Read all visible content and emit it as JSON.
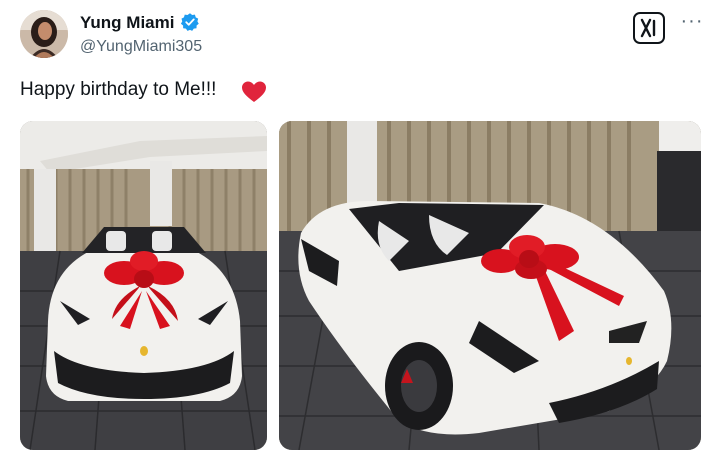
{
  "author": {
    "display_name": "Yung Miami",
    "handle": "@YungMiami305",
    "verified": true,
    "verified_color": "#1d9bf0"
  },
  "actions": {
    "brand_icon": "x-logo-icon",
    "more_icon": "more-options-icon",
    "more_label": "···"
  },
  "tweet": {
    "text": "Happy birthday to Me!!!",
    "emoji": "heart-icon",
    "emoji_color": "#e0243c"
  },
  "media": [
    {
      "subject": "white convertible sports car with a red gift bow, front view"
    },
    {
      "subject": "white convertible sports car with a red gift bow, three-quarter view"
    }
  ],
  "colors": {
    "text_primary": "#0f1419",
    "text_secondary": "#536471",
    "bow": "#d8121e",
    "car_body": "#f2f1ee"
  }
}
